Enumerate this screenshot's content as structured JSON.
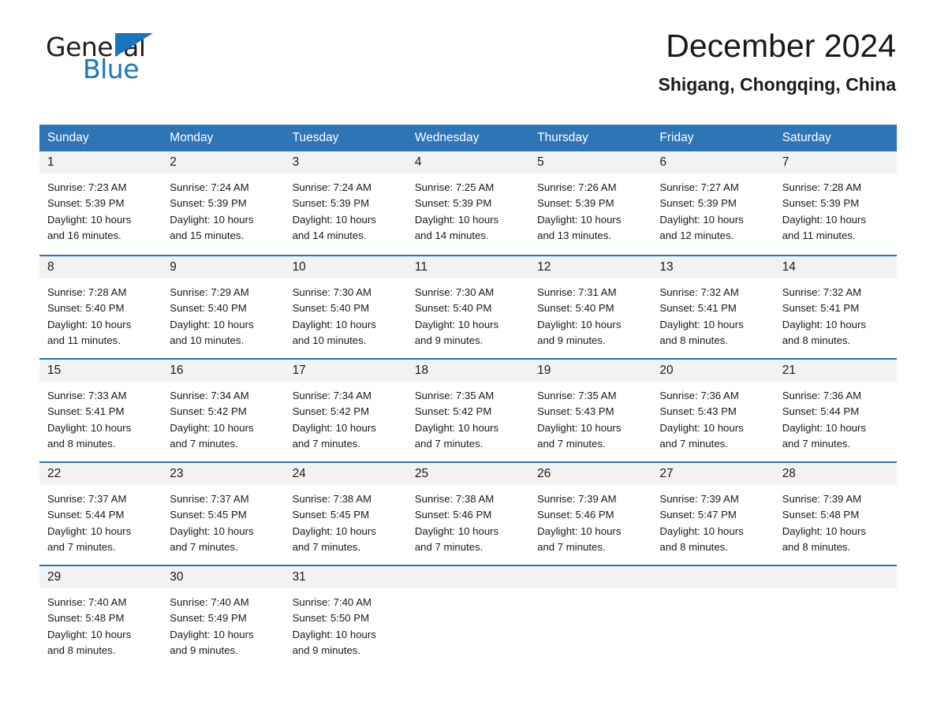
{
  "brand": {
    "word_one": "General",
    "word_two": "Blue",
    "logo_icon": "triangle-logo-icon"
  },
  "header": {
    "month_title": "December 2024",
    "location": "Shigang, Chongqing, China"
  },
  "colors": {
    "header_blue": "#2e75b6",
    "brand_blue": "#1b75bc",
    "daynum_band": "#f2f2f2",
    "text": "#1a1a1a"
  },
  "calendar": {
    "weekday_headers": [
      "Sunday",
      "Monday",
      "Tuesday",
      "Wednesday",
      "Thursday",
      "Friday",
      "Saturday"
    ],
    "weeks": [
      [
        {
          "day": "1",
          "sunrise": "Sunrise: 7:23 AM",
          "sunset": "Sunset: 5:39 PM",
          "daylight_1": "Daylight: 10 hours",
          "daylight_2": "and 16 minutes."
        },
        {
          "day": "2",
          "sunrise": "Sunrise: 7:24 AM",
          "sunset": "Sunset: 5:39 PM",
          "daylight_1": "Daylight: 10 hours",
          "daylight_2": "and 15 minutes."
        },
        {
          "day": "3",
          "sunrise": "Sunrise: 7:24 AM",
          "sunset": "Sunset: 5:39 PM",
          "daylight_1": "Daylight: 10 hours",
          "daylight_2": "and 14 minutes."
        },
        {
          "day": "4",
          "sunrise": "Sunrise: 7:25 AM",
          "sunset": "Sunset: 5:39 PM",
          "daylight_1": "Daylight: 10 hours",
          "daylight_2": "and 14 minutes."
        },
        {
          "day": "5",
          "sunrise": "Sunrise: 7:26 AM",
          "sunset": "Sunset: 5:39 PM",
          "daylight_1": "Daylight: 10 hours",
          "daylight_2": "and 13 minutes."
        },
        {
          "day": "6",
          "sunrise": "Sunrise: 7:27 AM",
          "sunset": "Sunset: 5:39 PM",
          "daylight_1": "Daylight: 10 hours",
          "daylight_2": "and 12 minutes."
        },
        {
          "day": "7",
          "sunrise": "Sunrise: 7:28 AM",
          "sunset": "Sunset: 5:39 PM",
          "daylight_1": "Daylight: 10 hours",
          "daylight_2": "and 11 minutes."
        }
      ],
      [
        {
          "day": "8",
          "sunrise": "Sunrise: 7:28 AM",
          "sunset": "Sunset: 5:40 PM",
          "daylight_1": "Daylight: 10 hours",
          "daylight_2": "and 11 minutes."
        },
        {
          "day": "9",
          "sunrise": "Sunrise: 7:29 AM",
          "sunset": "Sunset: 5:40 PM",
          "daylight_1": "Daylight: 10 hours",
          "daylight_2": "and 10 minutes."
        },
        {
          "day": "10",
          "sunrise": "Sunrise: 7:30 AM",
          "sunset": "Sunset: 5:40 PM",
          "daylight_1": "Daylight: 10 hours",
          "daylight_2": "and 10 minutes."
        },
        {
          "day": "11",
          "sunrise": "Sunrise: 7:30 AM",
          "sunset": "Sunset: 5:40 PM",
          "daylight_1": "Daylight: 10 hours",
          "daylight_2": "and 9 minutes."
        },
        {
          "day": "12",
          "sunrise": "Sunrise: 7:31 AM",
          "sunset": "Sunset: 5:40 PM",
          "daylight_1": "Daylight: 10 hours",
          "daylight_2": "and 9 minutes."
        },
        {
          "day": "13",
          "sunrise": "Sunrise: 7:32 AM",
          "sunset": "Sunset: 5:41 PM",
          "daylight_1": "Daylight: 10 hours",
          "daylight_2": "and 8 minutes."
        },
        {
          "day": "14",
          "sunrise": "Sunrise: 7:32 AM",
          "sunset": "Sunset: 5:41 PM",
          "daylight_1": "Daylight: 10 hours",
          "daylight_2": "and 8 minutes."
        }
      ],
      [
        {
          "day": "15",
          "sunrise": "Sunrise: 7:33 AM",
          "sunset": "Sunset: 5:41 PM",
          "daylight_1": "Daylight: 10 hours",
          "daylight_2": "and 8 minutes."
        },
        {
          "day": "16",
          "sunrise": "Sunrise: 7:34 AM",
          "sunset": "Sunset: 5:42 PM",
          "daylight_1": "Daylight: 10 hours",
          "daylight_2": "and 7 minutes."
        },
        {
          "day": "17",
          "sunrise": "Sunrise: 7:34 AM",
          "sunset": "Sunset: 5:42 PM",
          "daylight_1": "Daylight: 10 hours",
          "daylight_2": "and 7 minutes."
        },
        {
          "day": "18",
          "sunrise": "Sunrise: 7:35 AM",
          "sunset": "Sunset: 5:42 PM",
          "daylight_1": "Daylight: 10 hours",
          "daylight_2": "and 7 minutes."
        },
        {
          "day": "19",
          "sunrise": "Sunrise: 7:35 AM",
          "sunset": "Sunset: 5:43 PM",
          "daylight_1": "Daylight: 10 hours",
          "daylight_2": "and 7 minutes."
        },
        {
          "day": "20",
          "sunrise": "Sunrise: 7:36 AM",
          "sunset": "Sunset: 5:43 PM",
          "daylight_1": "Daylight: 10 hours",
          "daylight_2": "and 7 minutes."
        },
        {
          "day": "21",
          "sunrise": "Sunrise: 7:36 AM",
          "sunset": "Sunset: 5:44 PM",
          "daylight_1": "Daylight: 10 hours",
          "daylight_2": "and 7 minutes."
        }
      ],
      [
        {
          "day": "22",
          "sunrise": "Sunrise: 7:37 AM",
          "sunset": "Sunset: 5:44 PM",
          "daylight_1": "Daylight: 10 hours",
          "daylight_2": "and 7 minutes."
        },
        {
          "day": "23",
          "sunrise": "Sunrise: 7:37 AM",
          "sunset": "Sunset: 5:45 PM",
          "daylight_1": "Daylight: 10 hours",
          "daylight_2": "and 7 minutes."
        },
        {
          "day": "24",
          "sunrise": "Sunrise: 7:38 AM",
          "sunset": "Sunset: 5:45 PM",
          "daylight_1": "Daylight: 10 hours",
          "daylight_2": "and 7 minutes."
        },
        {
          "day": "25",
          "sunrise": "Sunrise: 7:38 AM",
          "sunset": "Sunset: 5:46 PM",
          "daylight_1": "Daylight: 10 hours",
          "daylight_2": "and 7 minutes."
        },
        {
          "day": "26",
          "sunrise": "Sunrise: 7:39 AM",
          "sunset": "Sunset: 5:46 PM",
          "daylight_1": "Daylight: 10 hours",
          "daylight_2": "and 7 minutes."
        },
        {
          "day": "27",
          "sunrise": "Sunrise: 7:39 AM",
          "sunset": "Sunset: 5:47 PM",
          "daylight_1": "Daylight: 10 hours",
          "daylight_2": "and 8 minutes."
        },
        {
          "day": "28",
          "sunrise": "Sunrise: 7:39 AM",
          "sunset": "Sunset: 5:48 PM",
          "daylight_1": "Daylight: 10 hours",
          "daylight_2": "and 8 minutes."
        }
      ],
      [
        {
          "day": "29",
          "sunrise": "Sunrise: 7:40 AM",
          "sunset": "Sunset: 5:48 PM",
          "daylight_1": "Daylight: 10 hours",
          "daylight_2": "and 8 minutes."
        },
        {
          "day": "30",
          "sunrise": "Sunrise: 7:40 AM",
          "sunset": "Sunset: 5:49 PM",
          "daylight_1": "Daylight: 10 hours",
          "daylight_2": "and 9 minutes."
        },
        {
          "day": "31",
          "sunrise": "Sunrise: 7:40 AM",
          "sunset": "Sunset: 5:50 PM",
          "daylight_1": "Daylight: 10 hours",
          "daylight_2": "and 9 minutes."
        },
        {
          "day": "",
          "sunrise": "",
          "sunset": "",
          "daylight_1": "",
          "daylight_2": ""
        },
        {
          "day": "",
          "sunrise": "",
          "sunset": "",
          "daylight_1": "",
          "daylight_2": ""
        },
        {
          "day": "",
          "sunrise": "",
          "sunset": "",
          "daylight_1": "",
          "daylight_2": ""
        },
        {
          "day": "",
          "sunrise": "",
          "sunset": "",
          "daylight_1": "",
          "daylight_2": ""
        }
      ]
    ]
  }
}
